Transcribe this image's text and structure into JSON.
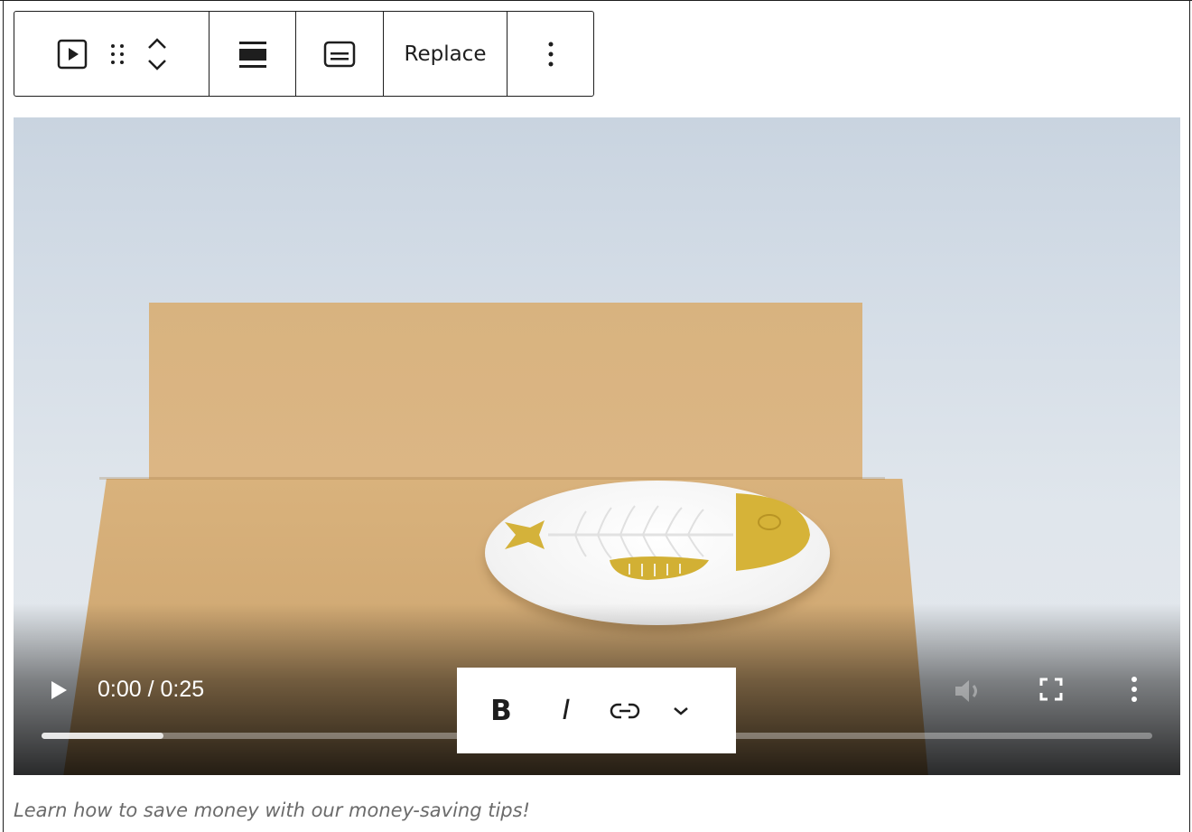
{
  "toolbar": {
    "block_type_icon": "video-block-icon",
    "drag_icon": "drag-handle-icon",
    "move_icon": "move-up-down-icon",
    "align_icon": "align-full-icon",
    "caption_icon": "caption-icon",
    "replace_label": "Replace",
    "options_icon": "more-vertical-icon"
  },
  "video": {
    "time_display": "0:00 / 0:25",
    "progress_buffered": 0.11,
    "controls": [
      "play-icon",
      "volume-icon",
      "fullscreen-icon",
      "more-vertical-icon"
    ]
  },
  "format_toolbar": {
    "bold_label": "B",
    "italic_label": "I",
    "link_icon": "link-icon",
    "more_icon": "chevron-down-icon"
  },
  "caption": {
    "text": "Learn how to save money with our money-saving tips!"
  },
  "colors": {
    "border": "#1e1e1e",
    "caption_text": "#6b6b6b"
  }
}
